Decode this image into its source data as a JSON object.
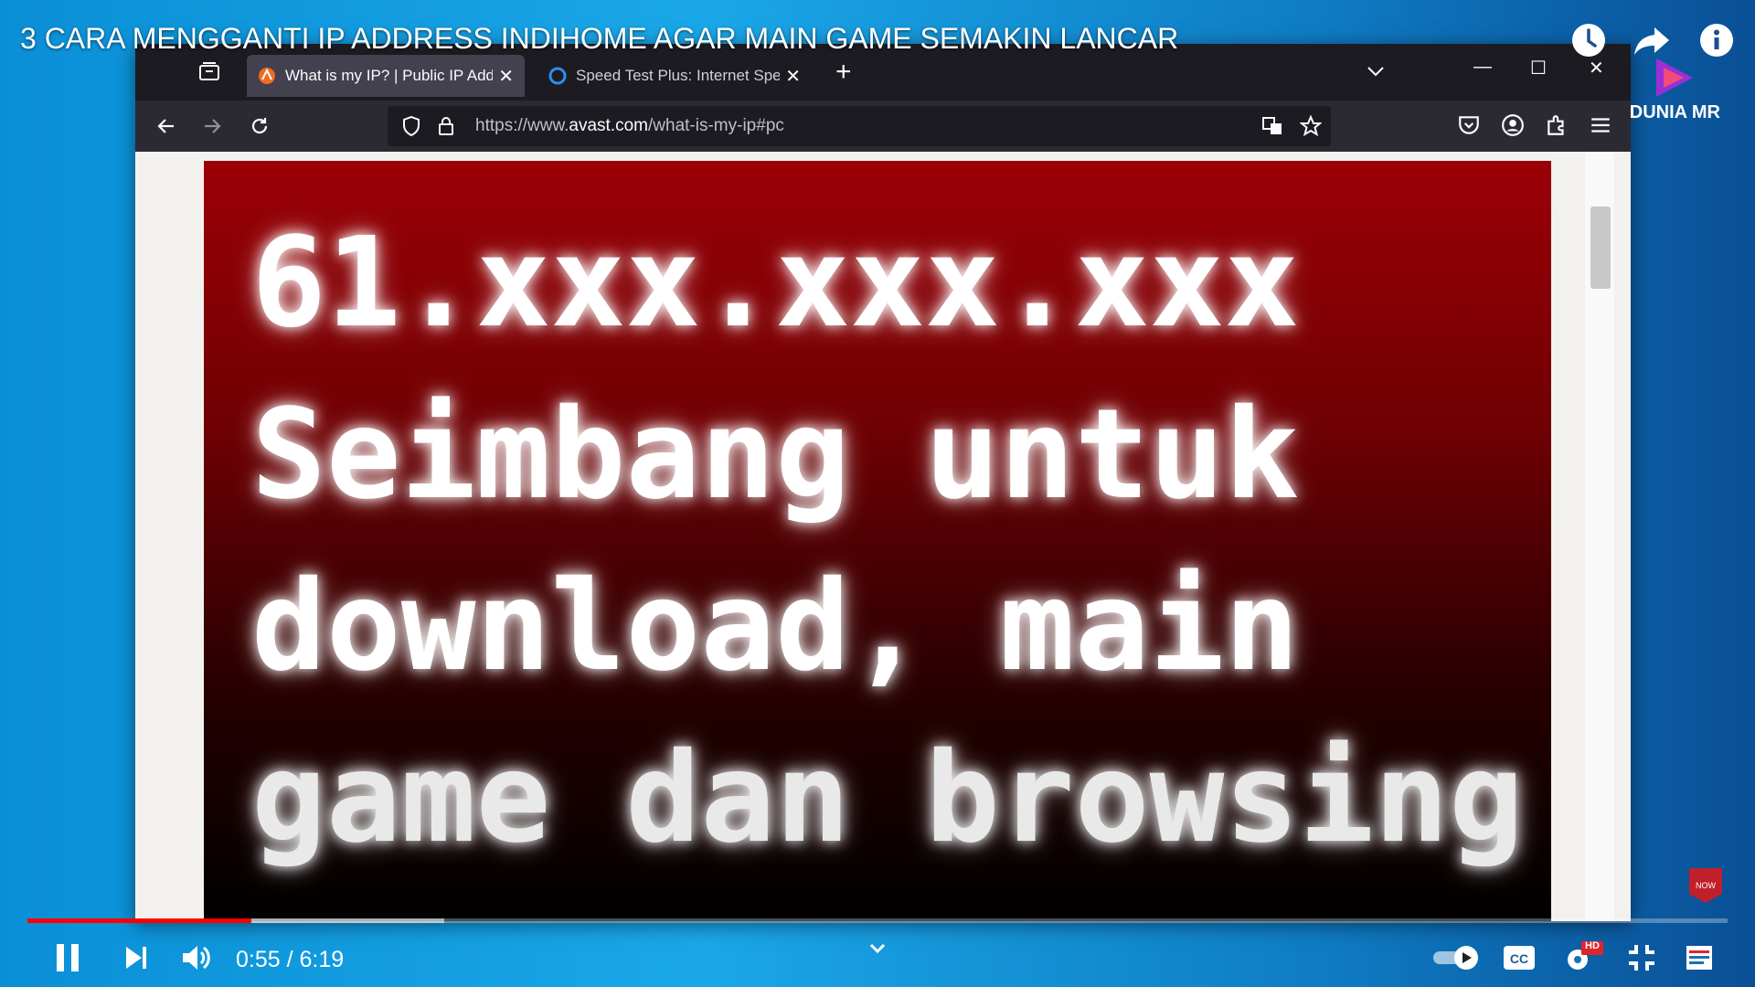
{
  "video": {
    "title": "3 CARA MENGGANTI IP ADDRESS INDIHOME AGAR MAIN GAME SEMAKIN LANCAR",
    "channel_name": "DUNIA MR",
    "top_icons": [
      "watch-later-icon",
      "share-icon",
      "info-icon"
    ]
  },
  "browser": {
    "tabs": [
      {
        "label": "What is my IP? | Public IP Address",
        "active": true
      },
      {
        "label": "Speed Test Plus: Internet Speed",
        "active": false
      }
    ],
    "url": {
      "prefix": "https://www.",
      "domain": "avast.com",
      "path": "/what-is-my-ip#pc"
    }
  },
  "overlay": {
    "lines": [
      "61.xxx.xxx.xxx",
      "Seimbang untuk",
      "download, main",
      "game dan browsing"
    ],
    "colors": {
      "top": "#9b0006",
      "bottom": "#000000"
    }
  },
  "player": {
    "time": "0:55 / 6:19",
    "progress_played": 0.1317,
    "progress_buffered": 0.245,
    "hd_badge": "HD",
    "autoplay": "on",
    "accent": "#ff0000"
  }
}
